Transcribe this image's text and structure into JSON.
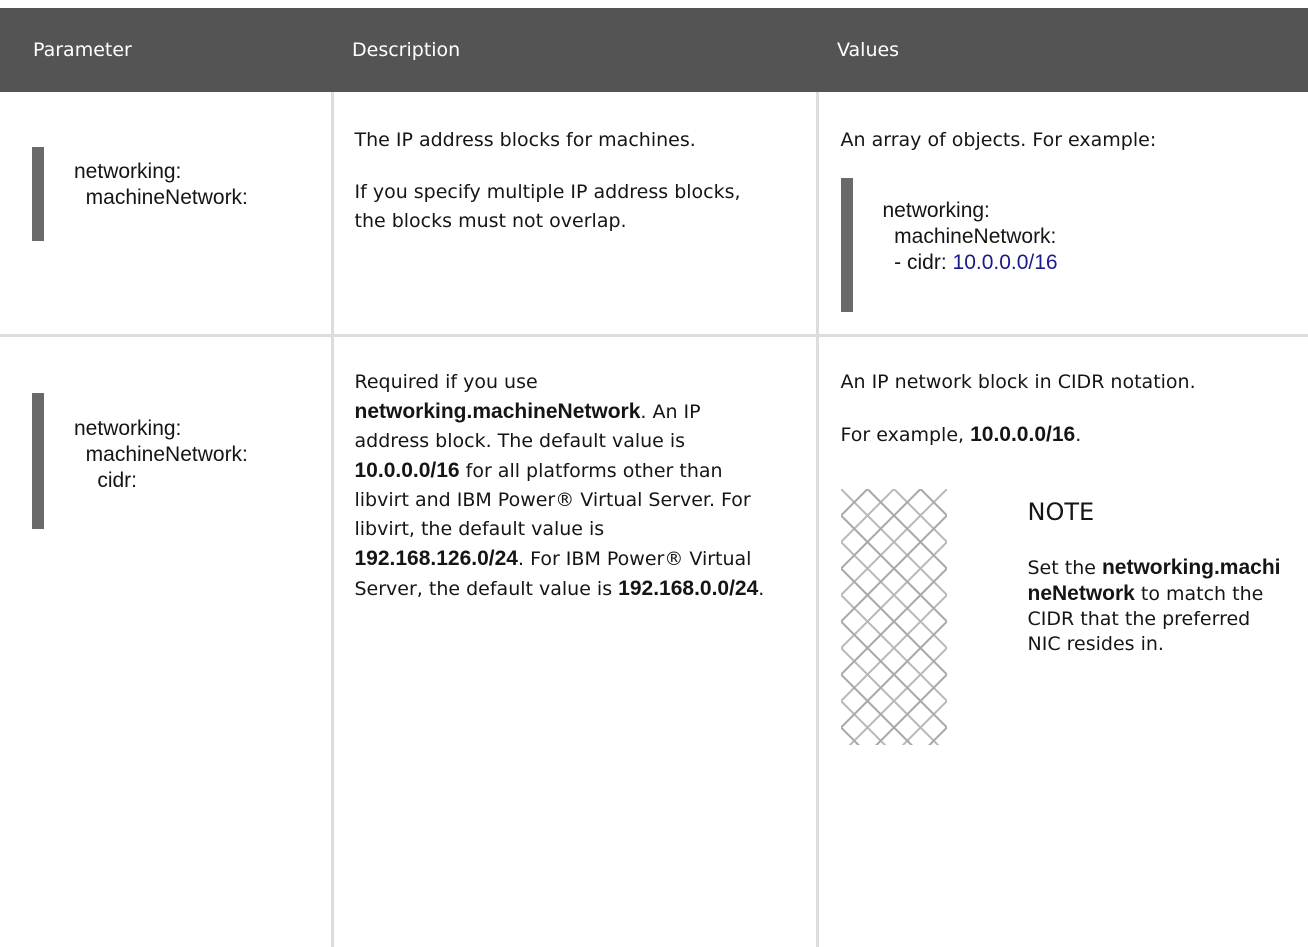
{
  "table": {
    "headers": [
      "Parameter",
      "Description",
      "Values"
    ],
    "rows": [
      {
        "parameter": [
          "networking:",
          "  machineNetwork:"
        ],
        "description": [
          "The IP address blocks for machines.",
          "If you specify multiple IP address blocks, the blocks must not overlap."
        ],
        "values": {
          "intro": "An array of objects. For example:",
          "example": {
            "line1": "networking:",
            "line2": "  machineNetwork:",
            "line3_prefix": "  - cidr: ",
            "line3_value": "10.0.0.0/16"
          }
        }
      },
      {
        "parameter": [
          "networking:",
          "  machineNetwork:",
          "    cidr:"
        ],
        "description": {
          "t1": "Required if you use ",
          "b1": "networking.machineNetwork",
          "t2": ". An IP address block. The default value is ",
          "b2": "10.0.0.0/16",
          "t3": " for all platforms other than libvirt and IBM Power® Virtual Server. For libvirt, the default value is ",
          "b3": "192.168.126.0/24",
          "t4": ". For IBM Power® Virtual Server, the default value is ",
          "b4": "192.168.0.0/24",
          "t5": "."
        },
        "values": {
          "intro": "An IP network block in CIDR notation.",
          "example_prefix": "For example, ",
          "example_value": "10.0.0.0/16",
          "example_suffix": ".",
          "note": {
            "title": "NOTE",
            "t1": "Set the ",
            "b1": "networking.machineNetwork",
            "t2": " to match the CIDR that the preferred NIC resides in."
          }
        }
      }
    ]
  }
}
